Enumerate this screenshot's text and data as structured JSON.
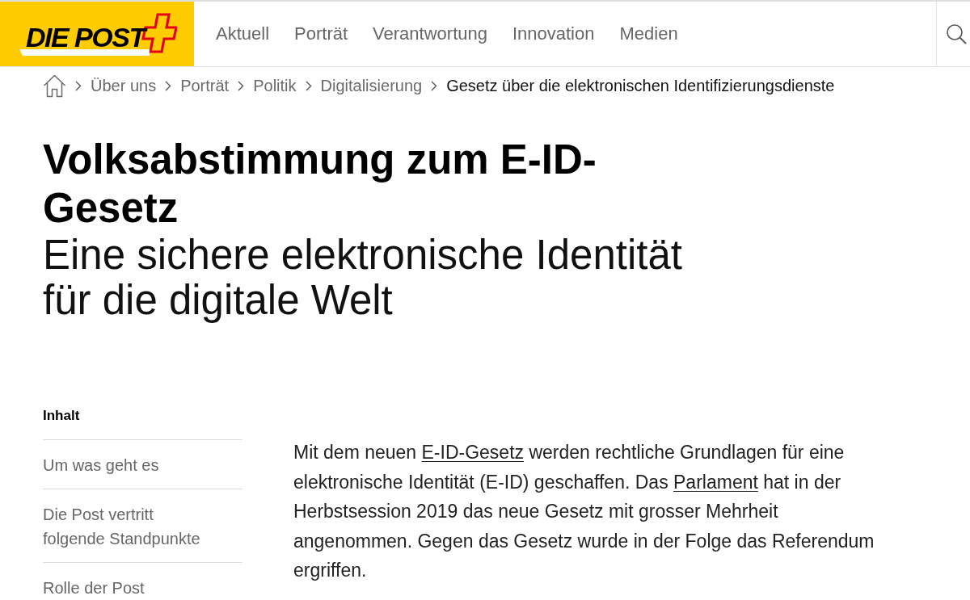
{
  "header": {
    "logo": {
      "text": "DIE POST"
    },
    "nav": [
      {
        "label": "Aktuell"
      },
      {
        "label": "Porträt"
      },
      {
        "label": "Verantwortung"
      },
      {
        "label": "Innovation"
      },
      {
        "label": "Medien"
      }
    ]
  },
  "breadcrumb": [
    {
      "label": "Über uns",
      "current": false
    },
    {
      "label": "Porträt",
      "current": false
    },
    {
      "label": "Politik",
      "current": false
    },
    {
      "label": "Digitalisierung",
      "current": false
    },
    {
      "label": "Gesetz über die elektronischen Identifizierungsdienste",
      "current": true
    }
  ],
  "title": "Volksabstimmung zum E-ID-Gesetz",
  "subtitle": "Eine sichere elektronische Identität für die digitale Welt",
  "toc": {
    "heading": "Inhalt",
    "items": [
      {
        "label": "Um was geht es"
      },
      {
        "label": "Die Post vertritt folgende Standpunkte"
      },
      {
        "label": "Rolle der Post"
      }
    ]
  },
  "intro": [
    {
      "kind": "text",
      "text": "Mit dem neuen "
    },
    {
      "kind": "link",
      "text": "E-ID-Gesetz"
    },
    {
      "kind": "text",
      "text": " werden rechtliche Grundlagen für eine elektronische Identität (E-ID) geschaffen. Das "
    },
    {
      "kind": "link",
      "text": "Parlament"
    },
    {
      "kind": "text",
      "text": " hat in der Herbstsession 2019 das neue Gesetz mit grosser Mehrheit angenommen. Gegen das Gesetz wurde in der Folge das Referendum ergriffen."
    }
  ]
}
